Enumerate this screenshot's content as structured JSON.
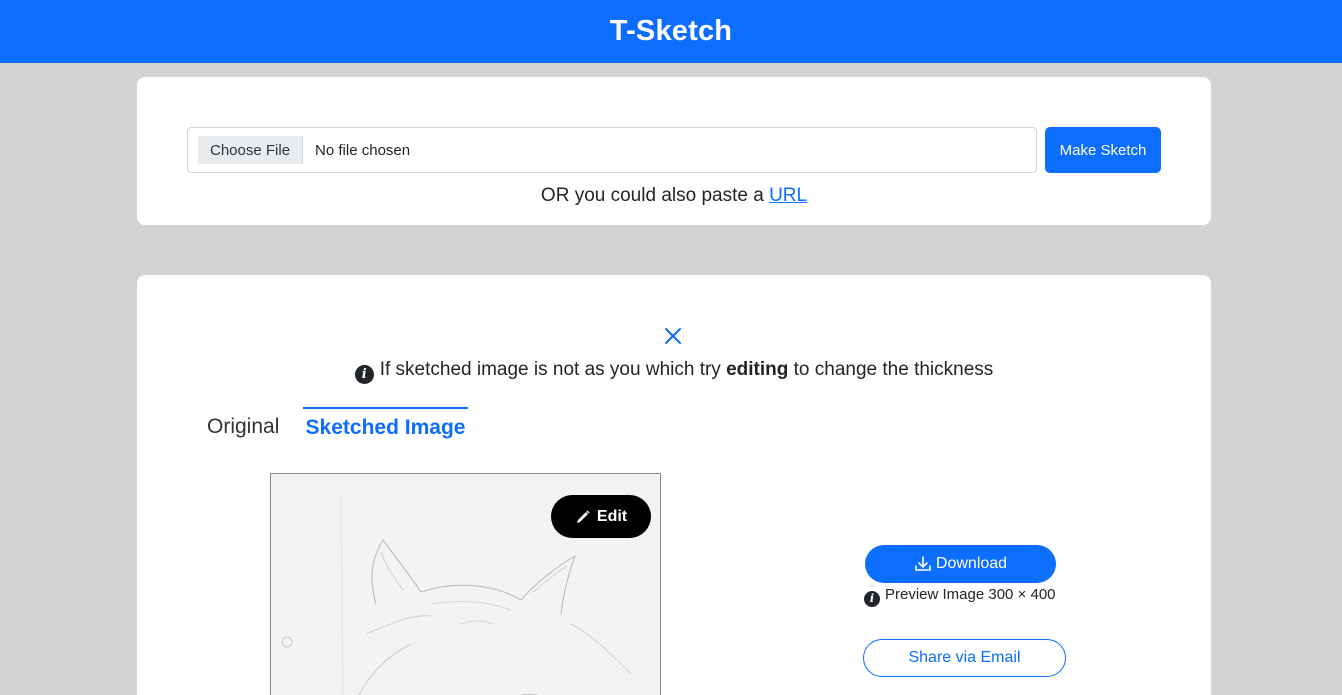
{
  "header": {
    "brand": "T-Sketch"
  },
  "upload": {
    "file_button_label": "Choose File",
    "file_status": "No file chosen",
    "submit_label": "Make Sketch",
    "paste_prefix": "OR you could also paste a ",
    "paste_link": "URL"
  },
  "result": {
    "info_prefix": "If sketched image is not as you which try ",
    "info_bold": "editing",
    "info_suffix": " to change the thickness",
    "tabs": [
      {
        "label": "Original",
        "active": false
      },
      {
        "label": "Sketched Image",
        "active": true
      }
    ],
    "edit_label": "Edit",
    "download_label": "Download",
    "preview_text": "Preview Image 300 × 400",
    "share_label": "Share via Email"
  },
  "colors": {
    "primary": "#0d6efd",
    "page_background": "#d3d3d3",
    "card_background": "#ffffff",
    "edit_button": "#000000"
  },
  "icons": [
    "close-icon",
    "info-icon",
    "pencil-icon",
    "download-icon"
  ]
}
